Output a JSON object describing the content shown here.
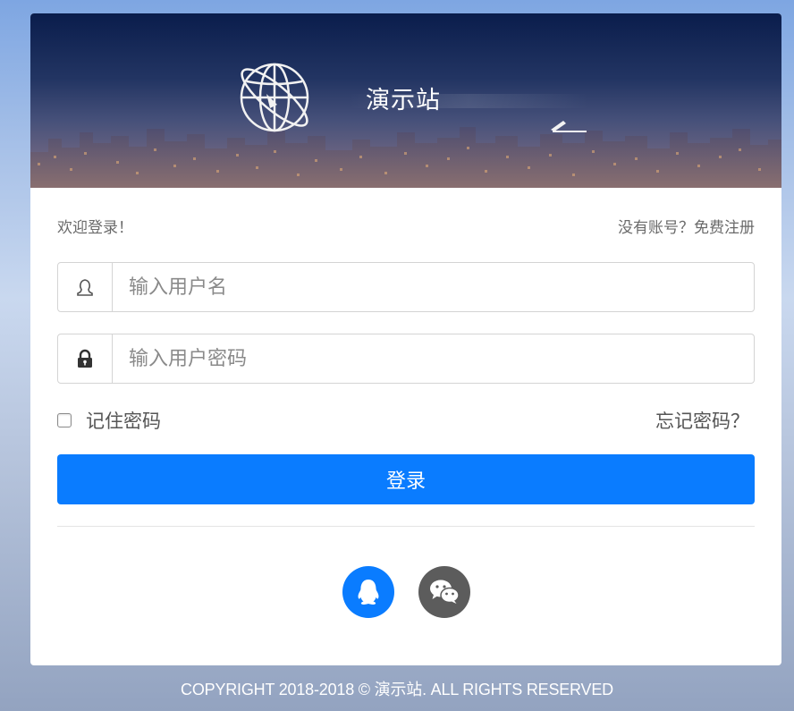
{
  "site": {
    "title": "演示站"
  },
  "login": {
    "welcome": "欢迎登录！",
    "register_link": "没有账号？免费注册",
    "username_placeholder": "输入用户名",
    "password_placeholder": "输入用户密码",
    "remember_label": "记住密码",
    "forgot_link": "忘记密码？",
    "submit_label": "登录"
  },
  "social": [
    {
      "name": "qq",
      "icon": "qq-penguin-icon",
      "color": "#0a7cff"
    },
    {
      "name": "wechat",
      "icon": "wechat-icon",
      "color": "#5c5c5c"
    }
  ],
  "footer": {
    "copyright": "COPYRIGHT 2018-2018 © 演示站. ALL RIGHTS RESERVED"
  },
  "colors": {
    "accent": "#0a7cff"
  }
}
